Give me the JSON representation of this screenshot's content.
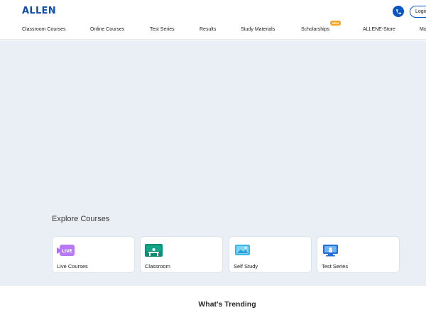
{
  "header": {
    "logo": "ALLEN",
    "login_label": "Login",
    "nav": [
      {
        "label": "Classroom Courses"
      },
      {
        "label": "Online Courses"
      },
      {
        "label": "Test Series"
      },
      {
        "label": "Results"
      },
      {
        "label": "Study Materials"
      },
      {
        "label": "Scholarships",
        "badge": "NEW"
      },
      {
        "label": "ALLENE-Store"
      },
      {
        "label": "More"
      }
    ]
  },
  "explore": {
    "title": "Explore Courses",
    "cards": [
      {
        "label": "Live Courses",
        "icon": "live-video-icon",
        "icon_text": "LIVE",
        "color": "#b06df0"
      },
      {
        "label": "Classroom",
        "icon": "classroom-board-icon",
        "color": "#0f8c73"
      },
      {
        "label": "Self Study",
        "icon": "self-study-icon",
        "color": "#3bb6e8"
      },
      {
        "label": "Test Series",
        "icon": "test-series-icon",
        "color": "#1f6fd6"
      }
    ]
  },
  "trending": {
    "title": "What's Trending"
  },
  "colors": {
    "brand": "#0b4fb3",
    "hero_bg": "#eaeff6",
    "badge": "#f5a623"
  }
}
